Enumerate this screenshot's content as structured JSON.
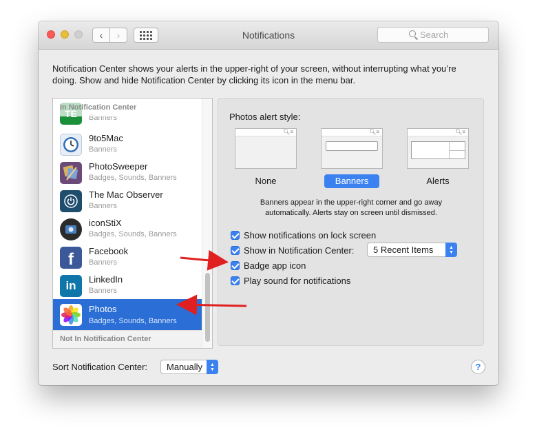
{
  "window": {
    "title": "Notifications",
    "search_placeholder": "Search"
  },
  "description": "Notification Center shows your alerts in the upper-right of your screen, without interrupting what you’re doing. Show and hide Notification Center by clicking its icon in the menu bar.",
  "list": {
    "header": "In Notification Center",
    "footer": "Not In Notification Center",
    "items": [
      {
        "name": "9to5Mac",
        "sub": "Banners",
        "icon": "clock-icon"
      },
      {
        "name": "PhotoSweeper",
        "sub": "Badges, Sounds, Banners",
        "icon": "photosweeper-icon"
      },
      {
        "name": "The Mac Observer",
        "sub": "Banners",
        "icon": "power-icon"
      },
      {
        "name": "iconStiX",
        "sub": "Badges, Sounds, Banners",
        "icon": "iconstix-icon"
      },
      {
        "name": "Facebook",
        "sub": "Banners",
        "icon": "facebook-icon"
      },
      {
        "name": "LinkedIn",
        "sub": "Banners",
        "icon": "linkedin-icon"
      },
      {
        "name": "Photos",
        "sub": "Badges, Sounds, Banners",
        "icon": "photos-icon",
        "selected": true
      }
    ],
    "partial_top": {
      "sub": "Banners",
      "icon": "app-icon"
    }
  },
  "panel": {
    "alert_style_label": "Photos alert style:",
    "styles": [
      "None",
      "Banners",
      "Alerts"
    ],
    "selected_style": "Banners",
    "hint": "Banners appear in the upper-right corner and go away automatically. Alerts stay on screen until dismissed.",
    "options": [
      {
        "label": "Show notifications on lock screen",
        "checked": true
      },
      {
        "label": "Show in Notification Center:",
        "checked": true
      },
      {
        "label": "Badge app icon",
        "checked": true
      },
      {
        "label": "Play sound for notifications",
        "checked": true
      }
    ],
    "recent_items": "5 Recent Items"
  },
  "footer": {
    "sort_label": "Sort Notification Center:",
    "sort_value": "Manually",
    "help": "?"
  },
  "colors": {
    "accent": "#3b82f0",
    "selection": "#2a6ed6",
    "annotation_arrow": "#e02020"
  }
}
